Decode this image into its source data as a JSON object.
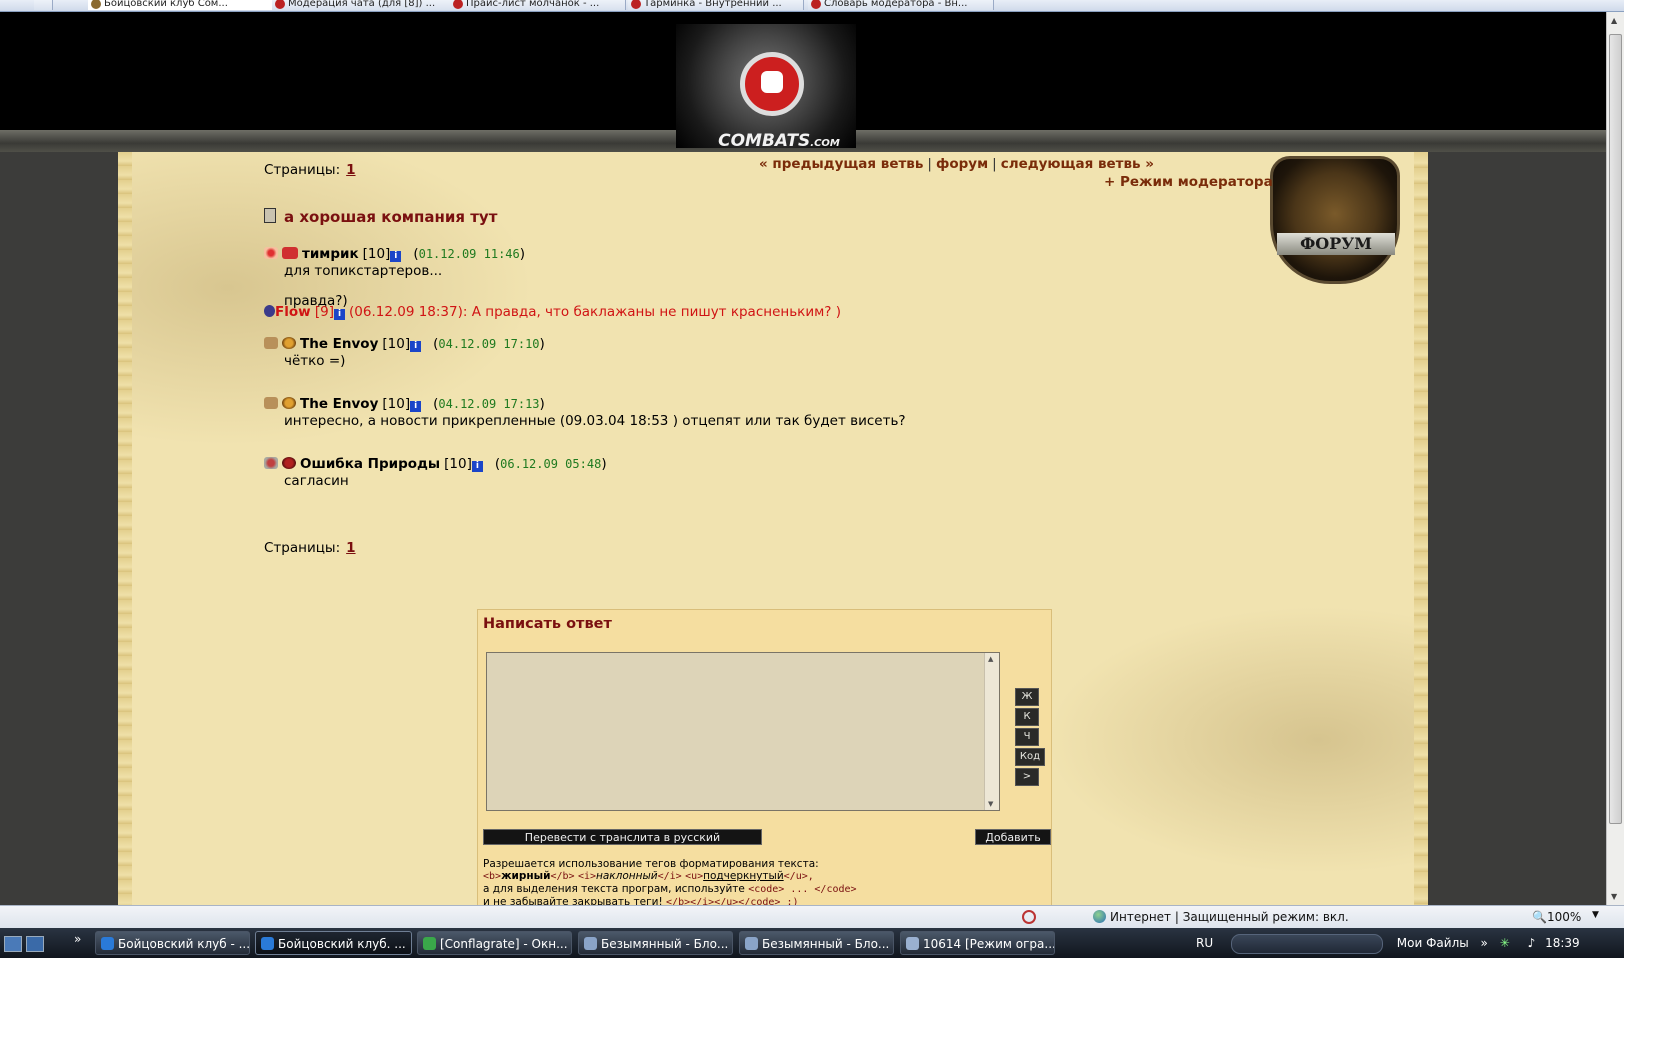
{
  "browser": {
    "tabs": [
      {
        "label": "Бойцовский клуб Сом..."
      },
      {
        "label": "Модерация чата (для [8]) ..."
      },
      {
        "label": "Прайс-лист молчанок - ..."
      },
      {
        "label": "Тарминка - Внутренний ..."
      },
      {
        "label": "Словарь модератора - Вн..."
      }
    ],
    "status": {
      "zone": "Интернет | Защищенный режим: вкл.",
      "zoom": "100%"
    }
  },
  "site": {
    "brand": "COMBATS",
    "brand_suffix": ".COM",
    "forum_shield": "ФОРУМ"
  },
  "forum": {
    "nav": {
      "prev": "« предыдущая ветвь",
      "forum": "форум",
      "next": "следующая ветвь »",
      "sep": "|"
    },
    "moderator_mode": "+ Режим модератора",
    "pages_label": "Страницы:",
    "page_num": "1",
    "topic_title": "а хорошая компания тут",
    "posts": [
      {
        "nick": "тимрик",
        "level": "[10]",
        "date": "01.12.09 11:46",
        "lines": [
          "для топикстартеров...",
          "",
          "правда?)"
        ],
        "mod_note": {
          "nick": "Flow",
          "level": "[9]",
          "text": "(06.12.09 18:37): А правда, что баклажаны не пишут красненьким? )"
        }
      },
      {
        "nick": "The Envoy",
        "level": "[10]",
        "date": "04.12.09 17:10",
        "lines": [
          "чётко =)"
        ]
      },
      {
        "nick": "The Envoy",
        "level": "[10]",
        "date": "04.12.09 17:13",
        "lines": [
          "интересно, а новости прикрепленные (09.03.04 18:53 ) отцепят или так будет висеть?"
        ]
      },
      {
        "nick": "Ошибка Природы",
        "level": "[10]",
        "date": "06.12.09 05:48",
        "lines": [
          "сагласин"
        ]
      }
    ]
  },
  "reply": {
    "title": "Написать ответ",
    "format_buttons": [
      "Ж",
      "К",
      "Ч",
      "Код",
      ">"
    ],
    "translit_button": "Перевести с транслита в русский",
    "submit_button": "Добавить",
    "hint_line1_pre": "Разрешается использование тегов форматирования текста:",
    "hint_b_open": "<b>",
    "hint_b_word": "жирный",
    "hint_b_close": "</b>",
    "hint_i_open": "<i>",
    "hint_i_word": "наклонный",
    "hint_i_close": "</i>",
    "hint_u_open": "<u>",
    "hint_u_word": "подчеркнутый",
    "hint_u_close": "</u>,",
    "hint_line3_pre": "а для выделения текста програм, используйте",
    "hint_code": "<code> ... </code>",
    "hint_line4": "и не забывайте закрывать теги!",
    "hint_line4_tags": "</b></i></u></code> :)"
  },
  "taskbar": {
    "buttons": [
      {
        "label": "Бойцовский клуб - ..."
      },
      {
        "label": "Бойцовский клуб. ..."
      },
      {
        "label": "[Conflagrate] - Окн..."
      },
      {
        "label": "Безымянный - Бло..."
      },
      {
        "label": "Безымянный - Бло..."
      },
      {
        "label": "10614 [Режим огра..."
      }
    ],
    "lang": "RU",
    "my_files": "Мои Файлы",
    "clock": "18:39"
  },
  "colors": {
    "accent": "#7a1010",
    "parchment": "#f1e3b0",
    "date_green": "#1f7a1f",
    "mod_red": "#d01414"
  },
  "icons": [
    "page-icon",
    "info-icon",
    "clan-icon",
    "align-icon",
    "globe-icon",
    "zoom-icon"
  ]
}
